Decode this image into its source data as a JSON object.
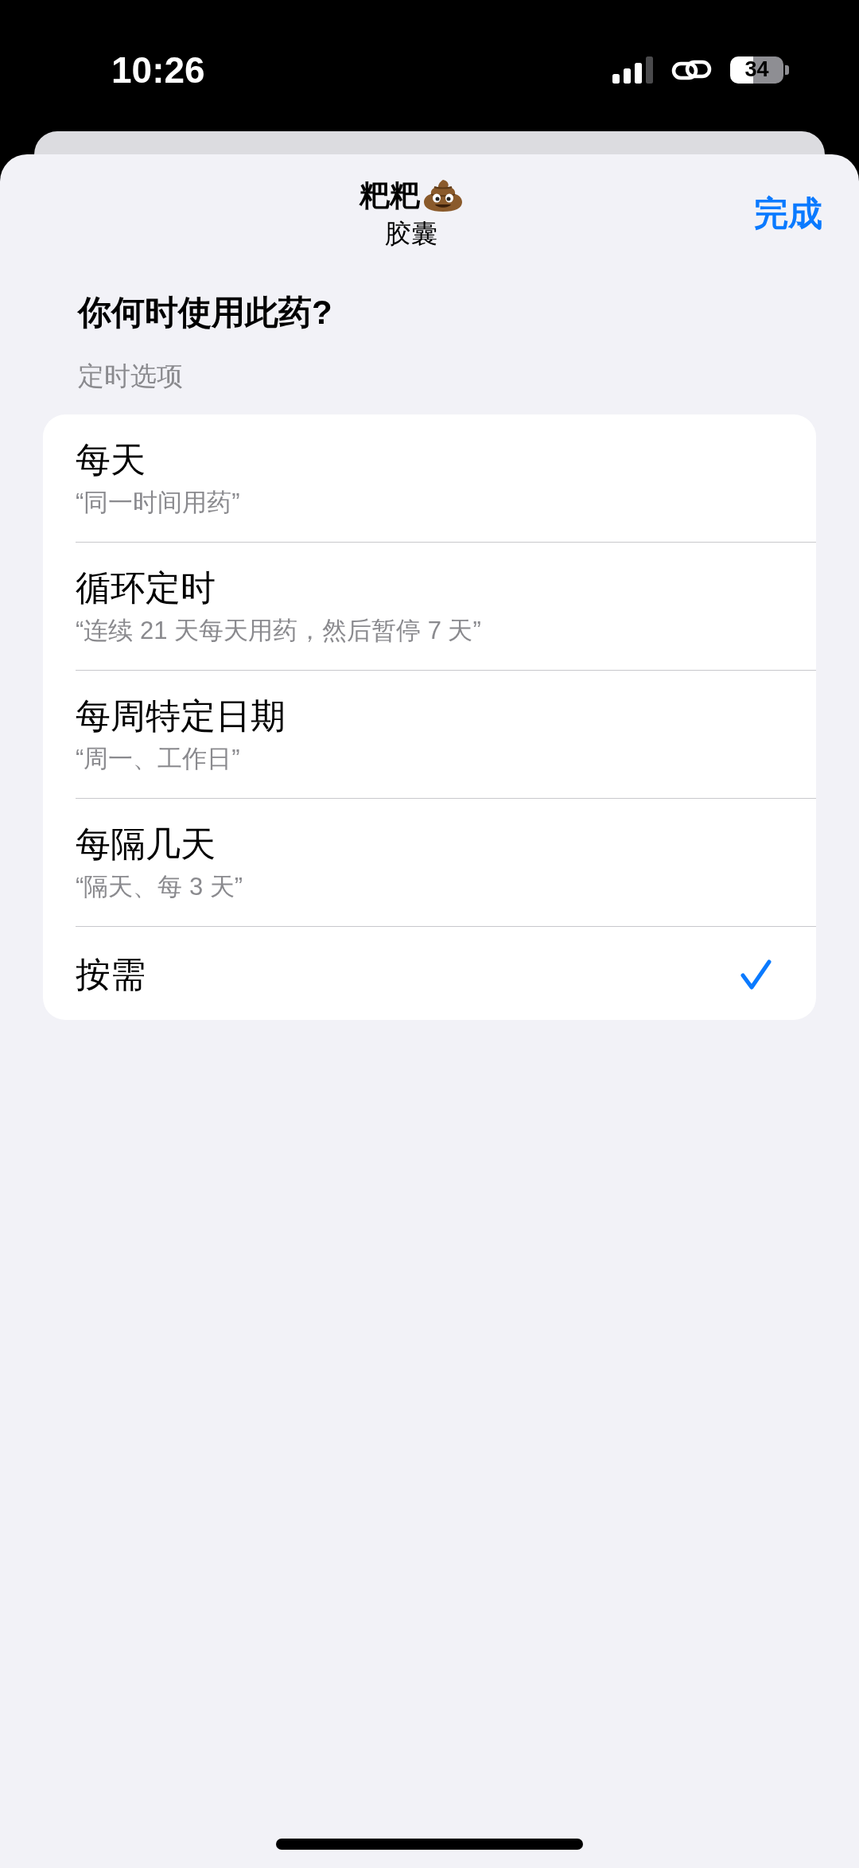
{
  "status_bar": {
    "time": "10:26",
    "battery": "34"
  },
  "header": {
    "title": "粑粑",
    "subtitle": "胶囊",
    "done_button": "完成"
  },
  "question": "你何时使用此药?",
  "section_header": "定时选项",
  "options": [
    {
      "label": "每天",
      "hint": "“同一时间用药”",
      "selected": false
    },
    {
      "label": "循环定时",
      "hint": "“连续 21 天每天用药，然后暂停 7 天”",
      "selected": false
    },
    {
      "label": "每周特定日期",
      "hint": "“周一、工作日”",
      "selected": false
    },
    {
      "label": "每隔几天",
      "hint": "“隔天、每 3 天”",
      "selected": false
    },
    {
      "label": "按需",
      "selected": true
    }
  ]
}
